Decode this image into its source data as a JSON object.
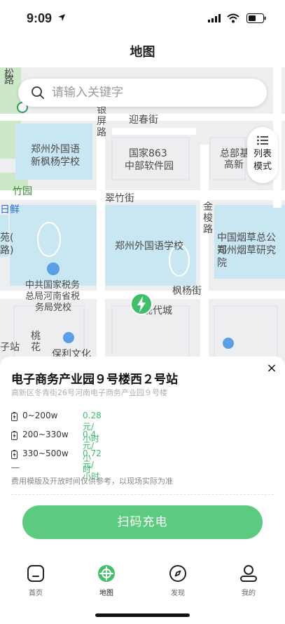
{
  "status_bar": {
    "time": "9:09"
  },
  "nav": {
    "title": "地图"
  },
  "search": {
    "placeholder": "请输入关键字"
  },
  "list_mode": {
    "label_line1": "列表",
    "label_line2": "模式"
  },
  "map_labels": {
    "l1": "郑州外国语",
    "l2": "新枫杨学校",
    "l3": "国家863",
    "l4": "中部软件园",
    "l5": "总部基",
    "l6": "高新",
    "l7": "迎春街",
    "l8": "银",
    "l9": "屏",
    "l10": "路",
    "l11": "竹园",
    "l12": "翠竹街",
    "l13": "金",
    "l14": "梭",
    "l15": "路",
    "l16": "日鲜",
    "l17": "郑州外国语学校",
    "l18": "中国烟草总公司",
    "l19": "郑州烟草研究院",
    "l20": "苑(",
    "l21": "路)",
    "l22": "中共国家税务",
    "l23": "总局河南省税",
    "l24": "务局党校",
    "l25": "枫杨街",
    "l26": "现代城",
    "l27": "子站",
    "l28": "桃",
    "l29": "花",
    "l30": "保利文化",
    "l31": "松",
    "l32": "路"
  },
  "station": {
    "name": "电子商务产业园９号楼西２号站",
    "address": "高新区冬青街26号河南电子商务产业园９号楼",
    "fees": [
      {
        "range": "0~200w",
        "price": "0.28元/小时"
      },
      {
        "range": "200~330w",
        "price": "0.4元/小时"
      },
      {
        "range": "330~500w",
        "price": "0.72元/小时"
      }
    ],
    "dash": "—",
    "note": "费用模版及开放时间仅供参考，以现场实际为准",
    "close_label": "×",
    "scan_button": "扫码充电"
  },
  "tabbar": {
    "items": [
      {
        "label": "首页",
        "icon": "home-icon"
      },
      {
        "label": "地图",
        "icon": "map-target-icon"
      },
      {
        "label": "发现",
        "icon": "compass-icon"
      },
      {
        "label": "我的",
        "icon": "person-icon"
      }
    ],
    "active_index": 1
  },
  "colors": {
    "accent": "#5ccb7f",
    "price": "#3cbf6e",
    "map_block": "#c9e7f2"
  }
}
